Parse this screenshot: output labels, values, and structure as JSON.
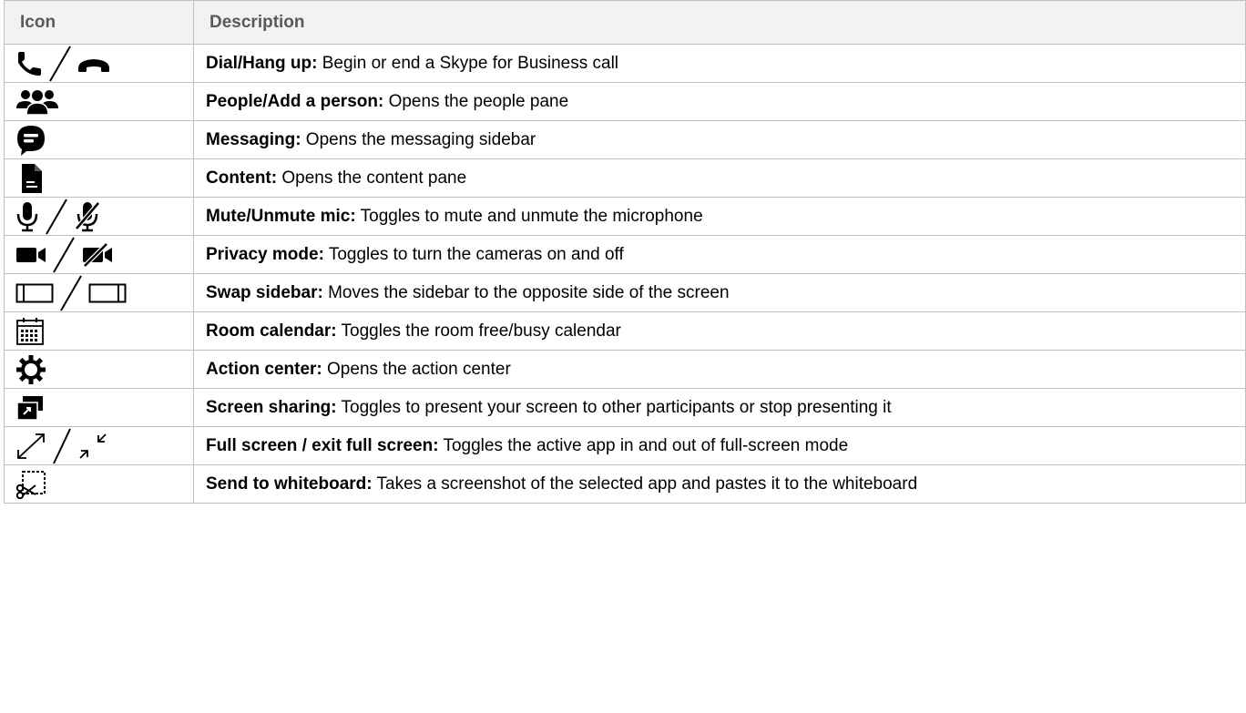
{
  "header": {
    "icon": "Icon",
    "description": "Description"
  },
  "rows": [
    {
      "icons": [
        "phone-icon",
        "hang-up-icon"
      ],
      "title": "Dial/Hang up:",
      "text": " Begin or end a Skype for Business call"
    },
    {
      "icons": [
        "people-icon"
      ],
      "title": "People/Add a person:",
      "text": " Opens the people pane"
    },
    {
      "icons": [
        "message-bubble-icon"
      ],
      "title": "Messaging:",
      "text": " Opens the messaging sidebar"
    },
    {
      "icons": [
        "document-icon"
      ],
      "title": "Content:",
      "text": " Opens the content pane"
    },
    {
      "icons": [
        "microphone-icon",
        "microphone-muted-icon"
      ],
      "title": "Mute/Unmute mic:",
      "text": " Toggles to mute and unmute the microphone"
    },
    {
      "icons": [
        "camera-icon",
        "camera-off-icon"
      ],
      "title": "Privacy mode:",
      "text": " Toggles to turn the cameras on and off"
    },
    {
      "icons": [
        "sidebar-left-icon",
        "sidebar-right-icon"
      ],
      "title": "Swap sidebar:",
      "text": " Moves the sidebar to the opposite side of the screen"
    },
    {
      "icons": [
        "calendar-icon"
      ],
      "title": "Room calendar:",
      "text": " Toggles the room free/busy calendar"
    },
    {
      "icons": [
        "gear-icon"
      ],
      "title": "Action center:",
      "text": " Opens the action center"
    },
    {
      "icons": [
        "screen-share-icon"
      ],
      "title": "Screen sharing:",
      "text": " Toggles to present your screen to other participants or stop presenting it"
    },
    {
      "icons": [
        "full-screen-icon",
        "exit-full-screen-icon"
      ],
      "title": "Full screen / exit full screen:",
      "text": " Toggles the active app in and out of full-screen mode"
    },
    {
      "icons": [
        "snip-to-whiteboard-icon"
      ],
      "title": "Send to whiteboard:",
      "text": " Takes a screenshot of the selected app and pastes it to the whiteboard"
    }
  ]
}
